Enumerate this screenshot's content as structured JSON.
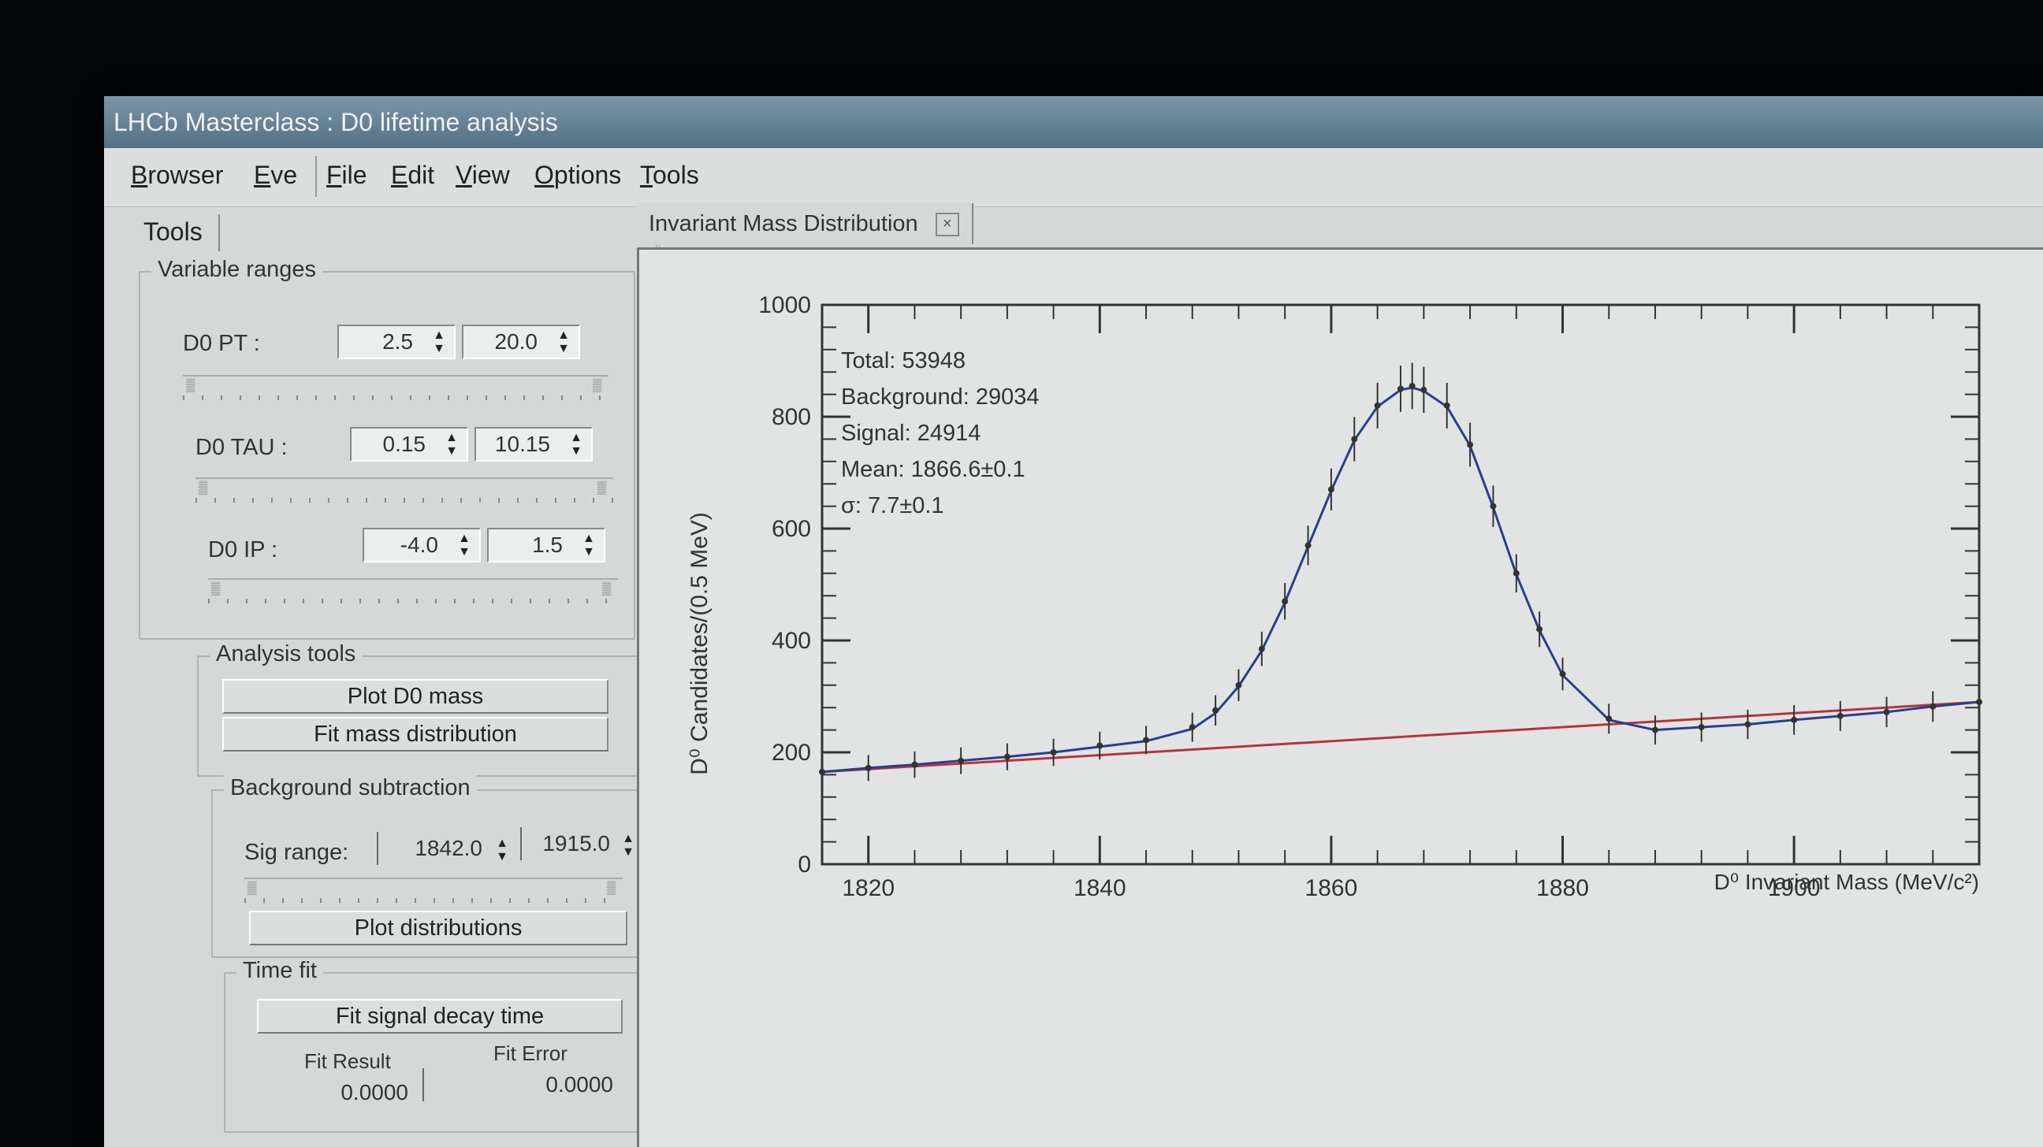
{
  "window": {
    "title": "LHCb Masterclass : D0 lifetime analysis"
  },
  "menu": [
    "Browser",
    "Eve",
    "File",
    "Edit",
    "View",
    "Options",
    "Tools"
  ],
  "left_panel": {
    "tab": "Tools",
    "variable_ranges": {
      "title": "Variable ranges",
      "rows": [
        {
          "label": "D0 PT :",
          "min": "2.5",
          "max": "20.0"
        },
        {
          "label": "D0 TAU :",
          "min": "0.15",
          "max": "10.15"
        },
        {
          "label": "D0 IP :",
          "min": "-4.0",
          "max": "1.5"
        }
      ]
    },
    "analysis_tools": {
      "title": "Analysis tools",
      "buttons": [
        "Plot D0 mass",
        "Fit mass distribution"
      ]
    },
    "background_subtraction": {
      "title": "Background subtraction",
      "sig_label": "Sig range:",
      "sig_min": "1842.0",
      "sig_max": "1915.0",
      "button": "Plot distributions"
    },
    "time_fit": {
      "title": "Time fit",
      "button": "Fit signal decay time",
      "result_label": "Fit Result",
      "error_label": "Fit Error",
      "result_value": "0.0000",
      "error_value": "0.0000"
    }
  },
  "canvas": {
    "tab": "Invariant Mass Distribution",
    "stats": [
      "Total: 53948",
      "Background: 29034",
      "Signal: 24914",
      "Mean: 1866.6±0.1",
      "σ: 7.7±0.1"
    ]
  },
  "chart_data": {
    "type": "scatter",
    "title": "",
    "xlabel": "D⁰ Invariant Mass (MeV/c²)",
    "ylabel": "D⁰ Candidates/(0.5 MeV)",
    "xlim": [
      1816,
      1916
    ],
    "ylim": [
      0,
      1000
    ],
    "x_ticks": [
      1820,
      1840,
      1860,
      1880,
      1900
    ],
    "y_ticks": [
      0,
      200,
      400,
      600,
      800,
      1000
    ],
    "legend": "none",
    "series": [
      {
        "kind": "data-points",
        "color": "#333333",
        "x": [
          1816,
          1820,
          1824,
          1828,
          1832,
          1836,
          1840,
          1844,
          1848,
          1850,
          1852,
          1854,
          1856,
          1858,
          1860,
          1862,
          1864,
          1866,
          1867,
          1868,
          1870,
          1872,
          1874,
          1876,
          1878,
          1880,
          1884,
          1888,
          1892,
          1896,
          1900,
          1904,
          1908,
          1912,
          1916
        ],
        "y": [
          165,
          172,
          178,
          185,
          192,
          200,
          212,
          222,
          245,
          275,
          320,
          385,
          470,
          570,
          670,
          760,
          820,
          850,
          855,
          848,
          820,
          750,
          640,
          520,
          420,
          340,
          260,
          240,
          245,
          250,
          258,
          265,
          272,
          282,
          290
        ]
      },
      {
        "kind": "fit-total",
        "color": "#2a3f8a",
        "x": [
          1816,
          1820,
          1824,
          1828,
          1832,
          1836,
          1840,
          1844,
          1848,
          1850,
          1852,
          1854,
          1856,
          1858,
          1860,
          1862,
          1864,
          1866,
          1867,
          1868,
          1870,
          1872,
          1874,
          1876,
          1878,
          1880,
          1884,
          1888,
          1892,
          1896,
          1900,
          1904,
          1908,
          1912,
          1916
        ],
        "y": [
          165,
          172,
          178,
          185,
          192,
          200,
          210,
          220,
          242,
          270,
          318,
          382,
          468,
          568,
          668,
          758,
          818,
          848,
          852,
          846,
          818,
          748,
          638,
          518,
          418,
          338,
          258,
          240,
          245,
          250,
          258,
          265,
          272,
          282,
          290
        ]
      },
      {
        "kind": "fit-background",
        "color": "#b5343c",
        "x": [
          1816,
          1916
        ],
        "y": [
          165,
          290
        ]
      }
    ]
  }
}
